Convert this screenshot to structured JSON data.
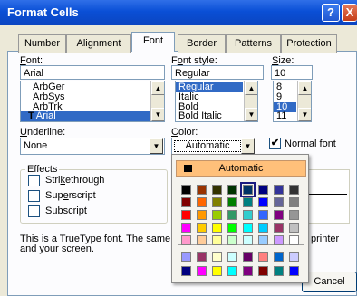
{
  "window": {
    "title": "Format Cells",
    "help": "?",
    "close": "X"
  },
  "tabs": [
    "Number",
    "Alignment",
    "Font",
    "Border",
    "Patterns",
    "Protection"
  ],
  "font": {
    "label_u": "F",
    "label_rest": "ont:",
    "value": "Arial",
    "items": [
      "ArbGer",
      "ArbSys",
      "ArbTrk",
      "Arial"
    ],
    "tt_glyph": "T"
  },
  "style": {
    "label_a": "F",
    "label_u": "o",
    "label_rest": "nt style:",
    "value": "Regular",
    "items": [
      "Regular",
      "Italic",
      "Bold",
      "Bold Italic"
    ]
  },
  "size": {
    "label_u": "S",
    "label_rest": "ize:",
    "value": "10",
    "items": [
      "8",
      "9",
      "10",
      "11"
    ]
  },
  "underline": {
    "label_u": "U",
    "label_rest": "nderline:",
    "value": "None"
  },
  "color": {
    "label_u": "C",
    "label_rest": "olor:",
    "value": "Automatic"
  },
  "normal_font": {
    "checked": "✔",
    "label_u": "N",
    "label_rest": "ormal font"
  },
  "effects": {
    "title": "Effects",
    "strike_a": "Stri",
    "strike_u": "k",
    "strike_b": "ethrough",
    "super_a": "Sup",
    "super_u": "e",
    "super_b": "rscript",
    "sub_a": "Su",
    "sub_u": "b",
    "sub_b": "script"
  },
  "note": {
    "line1_a": "This is a TrueType font.  The same",
    "line1_b": "printer",
    "line2": "and your screen."
  },
  "palette": {
    "automatic_label": "Automatic",
    "rows": [
      [
        "#000000",
        "#993300",
        "#333300",
        "#003300",
        "#003366",
        "#000080",
        "#333399",
        "#333333"
      ],
      [
        "#800000",
        "#FF6600",
        "#808000",
        "#008000",
        "#008080",
        "#0000FF",
        "#666699",
        "#808080"
      ],
      [
        "#FF0000",
        "#FF9900",
        "#99CC00",
        "#339966",
        "#33CCCC",
        "#3366FF",
        "#800080",
        "#969696"
      ],
      [
        "#FF00FF",
        "#FFCC00",
        "#FFFF00",
        "#00FF00",
        "#00FFFF",
        "#00CCFF",
        "#993366",
        "#C0C0C0"
      ],
      [
        "#FF99CC",
        "#FFCC99",
        "#FFFF99",
        "#CCFFCC",
        "#CCFFFF",
        "#99CCFF",
        "#CC99FF",
        "#FFFFFF"
      ],
      [
        "#9999FF",
        "#993366",
        "#FFFFCC",
        "#CCFFFF",
        "#660066",
        "#FF8080",
        "#0066CC",
        "#CCCCFF"
      ],
      [
        "#000080",
        "#FF00FF",
        "#FFFF00",
        "#00FFFF",
        "#800080",
        "#800000",
        "#008080",
        "#0000FF"
      ]
    ],
    "selected": "#003366"
  },
  "buttons": {
    "cancel": "Cancel"
  }
}
